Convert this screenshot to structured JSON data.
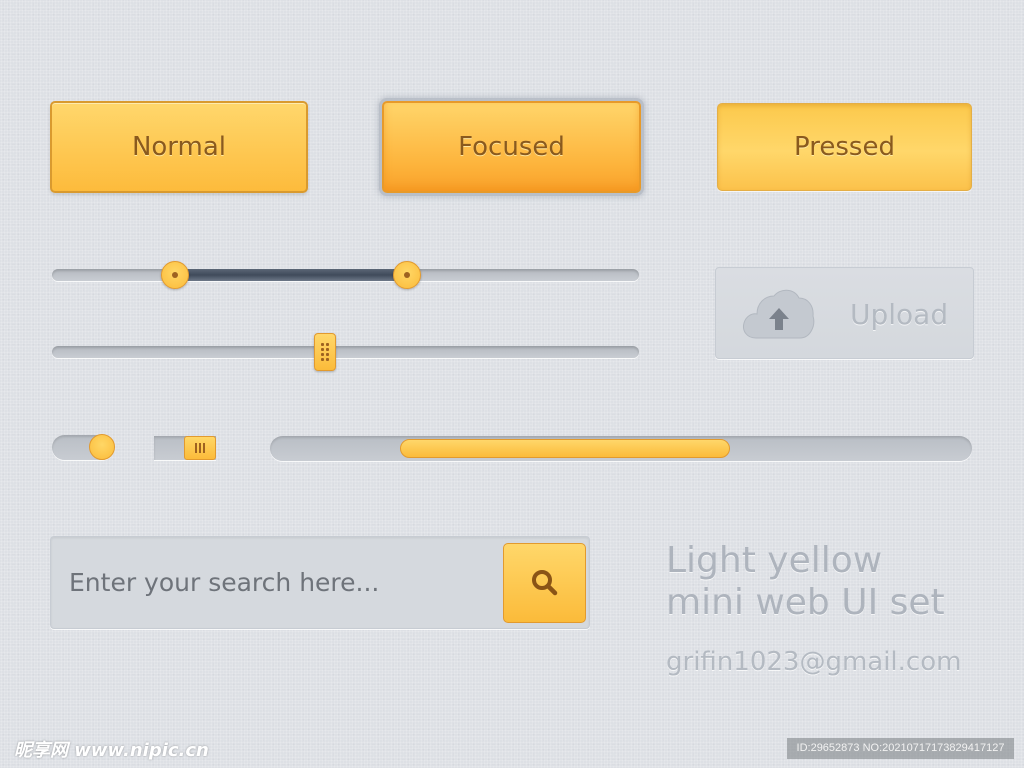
{
  "buttons": {
    "normal": "Normal",
    "focused": "Focused",
    "pressed": "Pressed"
  },
  "range_slider": {
    "low": 0.21,
    "high": 0.605
  },
  "single_slider": {
    "value": 0.465
  },
  "upload": {
    "label": "Upload",
    "icon": "cloud-upload-icon"
  },
  "toggles": [
    {
      "name": "round-toggle",
      "state": "on"
    },
    {
      "name": "grip-toggle",
      "state": "on"
    }
  ],
  "progress": {
    "start": 0.185,
    "end": 0.655
  },
  "search": {
    "placeholder": "Enter your search here...",
    "value": "",
    "icon": "search-icon"
  },
  "title": {
    "line1": "Light yellow",
    "line2": "mini web UI set"
  },
  "email": "grifin1023@gmail.com",
  "watermark": {
    "left": "昵享网 www.nipic.cn",
    "right": "ID:29652873 NO:20210717173829417127"
  },
  "colors": {
    "accent": "#fbbb3a",
    "accent_border": "#e29a2e",
    "text_brown": "#8a5a1e",
    "background": "#dde0e5",
    "range_dark": "#404b5b"
  }
}
